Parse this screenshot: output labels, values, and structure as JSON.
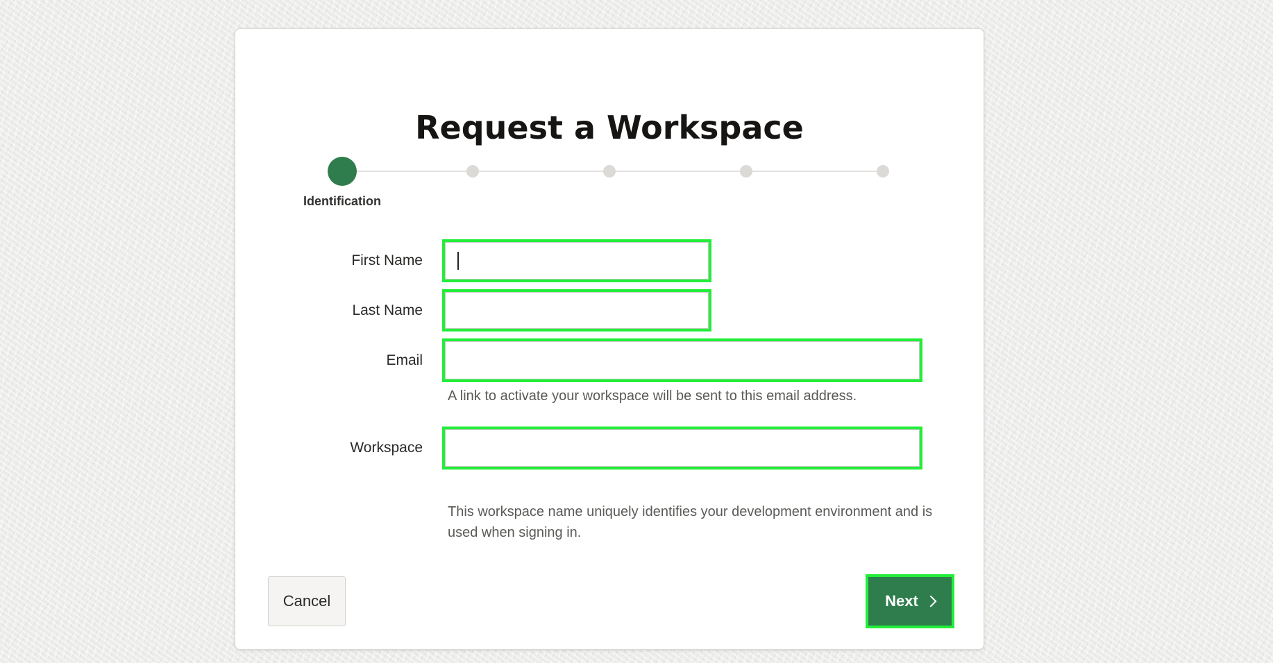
{
  "page": {
    "title": "Request a Workspace"
  },
  "wizard": {
    "steps": [
      {
        "label": "Identification",
        "active": true
      },
      {
        "label": "",
        "active": false
      },
      {
        "label": "",
        "active": false
      },
      {
        "label": "",
        "active": false
      },
      {
        "label": "",
        "active": false
      }
    ]
  },
  "form": {
    "first_name": {
      "label": "First Name",
      "value": ""
    },
    "last_name": {
      "label": "Last Name",
      "value": ""
    },
    "email": {
      "label": "Email",
      "value": "",
      "help": "A link to activate your workspace will be sent to this email address."
    },
    "workspace": {
      "label": "Workspace",
      "value": "",
      "help": "This workspace name uniquely identifies your development environment and is used when signing in."
    }
  },
  "actions": {
    "cancel_label": "Cancel",
    "next_label": "Next"
  },
  "colors": {
    "accent": "#2f7d4d",
    "highlight": "#22ee3a"
  }
}
